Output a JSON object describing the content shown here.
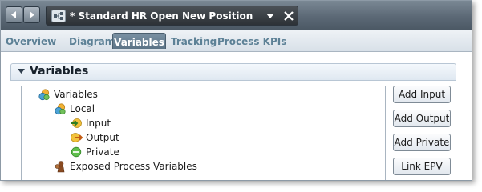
{
  "editor": {
    "title": "* Standard HR Open New Position"
  },
  "tabs": [
    {
      "label": "Overview"
    },
    {
      "label": "Diagram"
    },
    {
      "label": "Variables"
    },
    {
      "label": "Tracking"
    },
    {
      "label": "Process KPIs"
    }
  ],
  "active_tab": "Variables",
  "section": {
    "title": "Variables"
  },
  "tree": {
    "items": [
      {
        "label": "Variables",
        "icon": "variables-group-icon",
        "level": 0
      },
      {
        "label": "Local",
        "icon": "variables-group-icon",
        "level": 1
      },
      {
        "label": "Input",
        "icon": "input-variable-icon",
        "level": 2
      },
      {
        "label": "Output",
        "icon": "output-variable-icon",
        "level": 2
      },
      {
        "label": "Private",
        "icon": "private-variable-icon",
        "level": 2
      },
      {
        "label": "Exposed Process Variables",
        "icon": "exposed-variables-icon",
        "level": 1
      }
    ]
  },
  "buttons": {
    "add_input": "Add Input",
    "add_output": "Add Output",
    "add_private": "Add Private",
    "link_epv": "Link EPV"
  },
  "colors": {
    "titlebar": "#5b6875",
    "tab_text": "#5d8196",
    "active_tab": "#6a8295"
  }
}
